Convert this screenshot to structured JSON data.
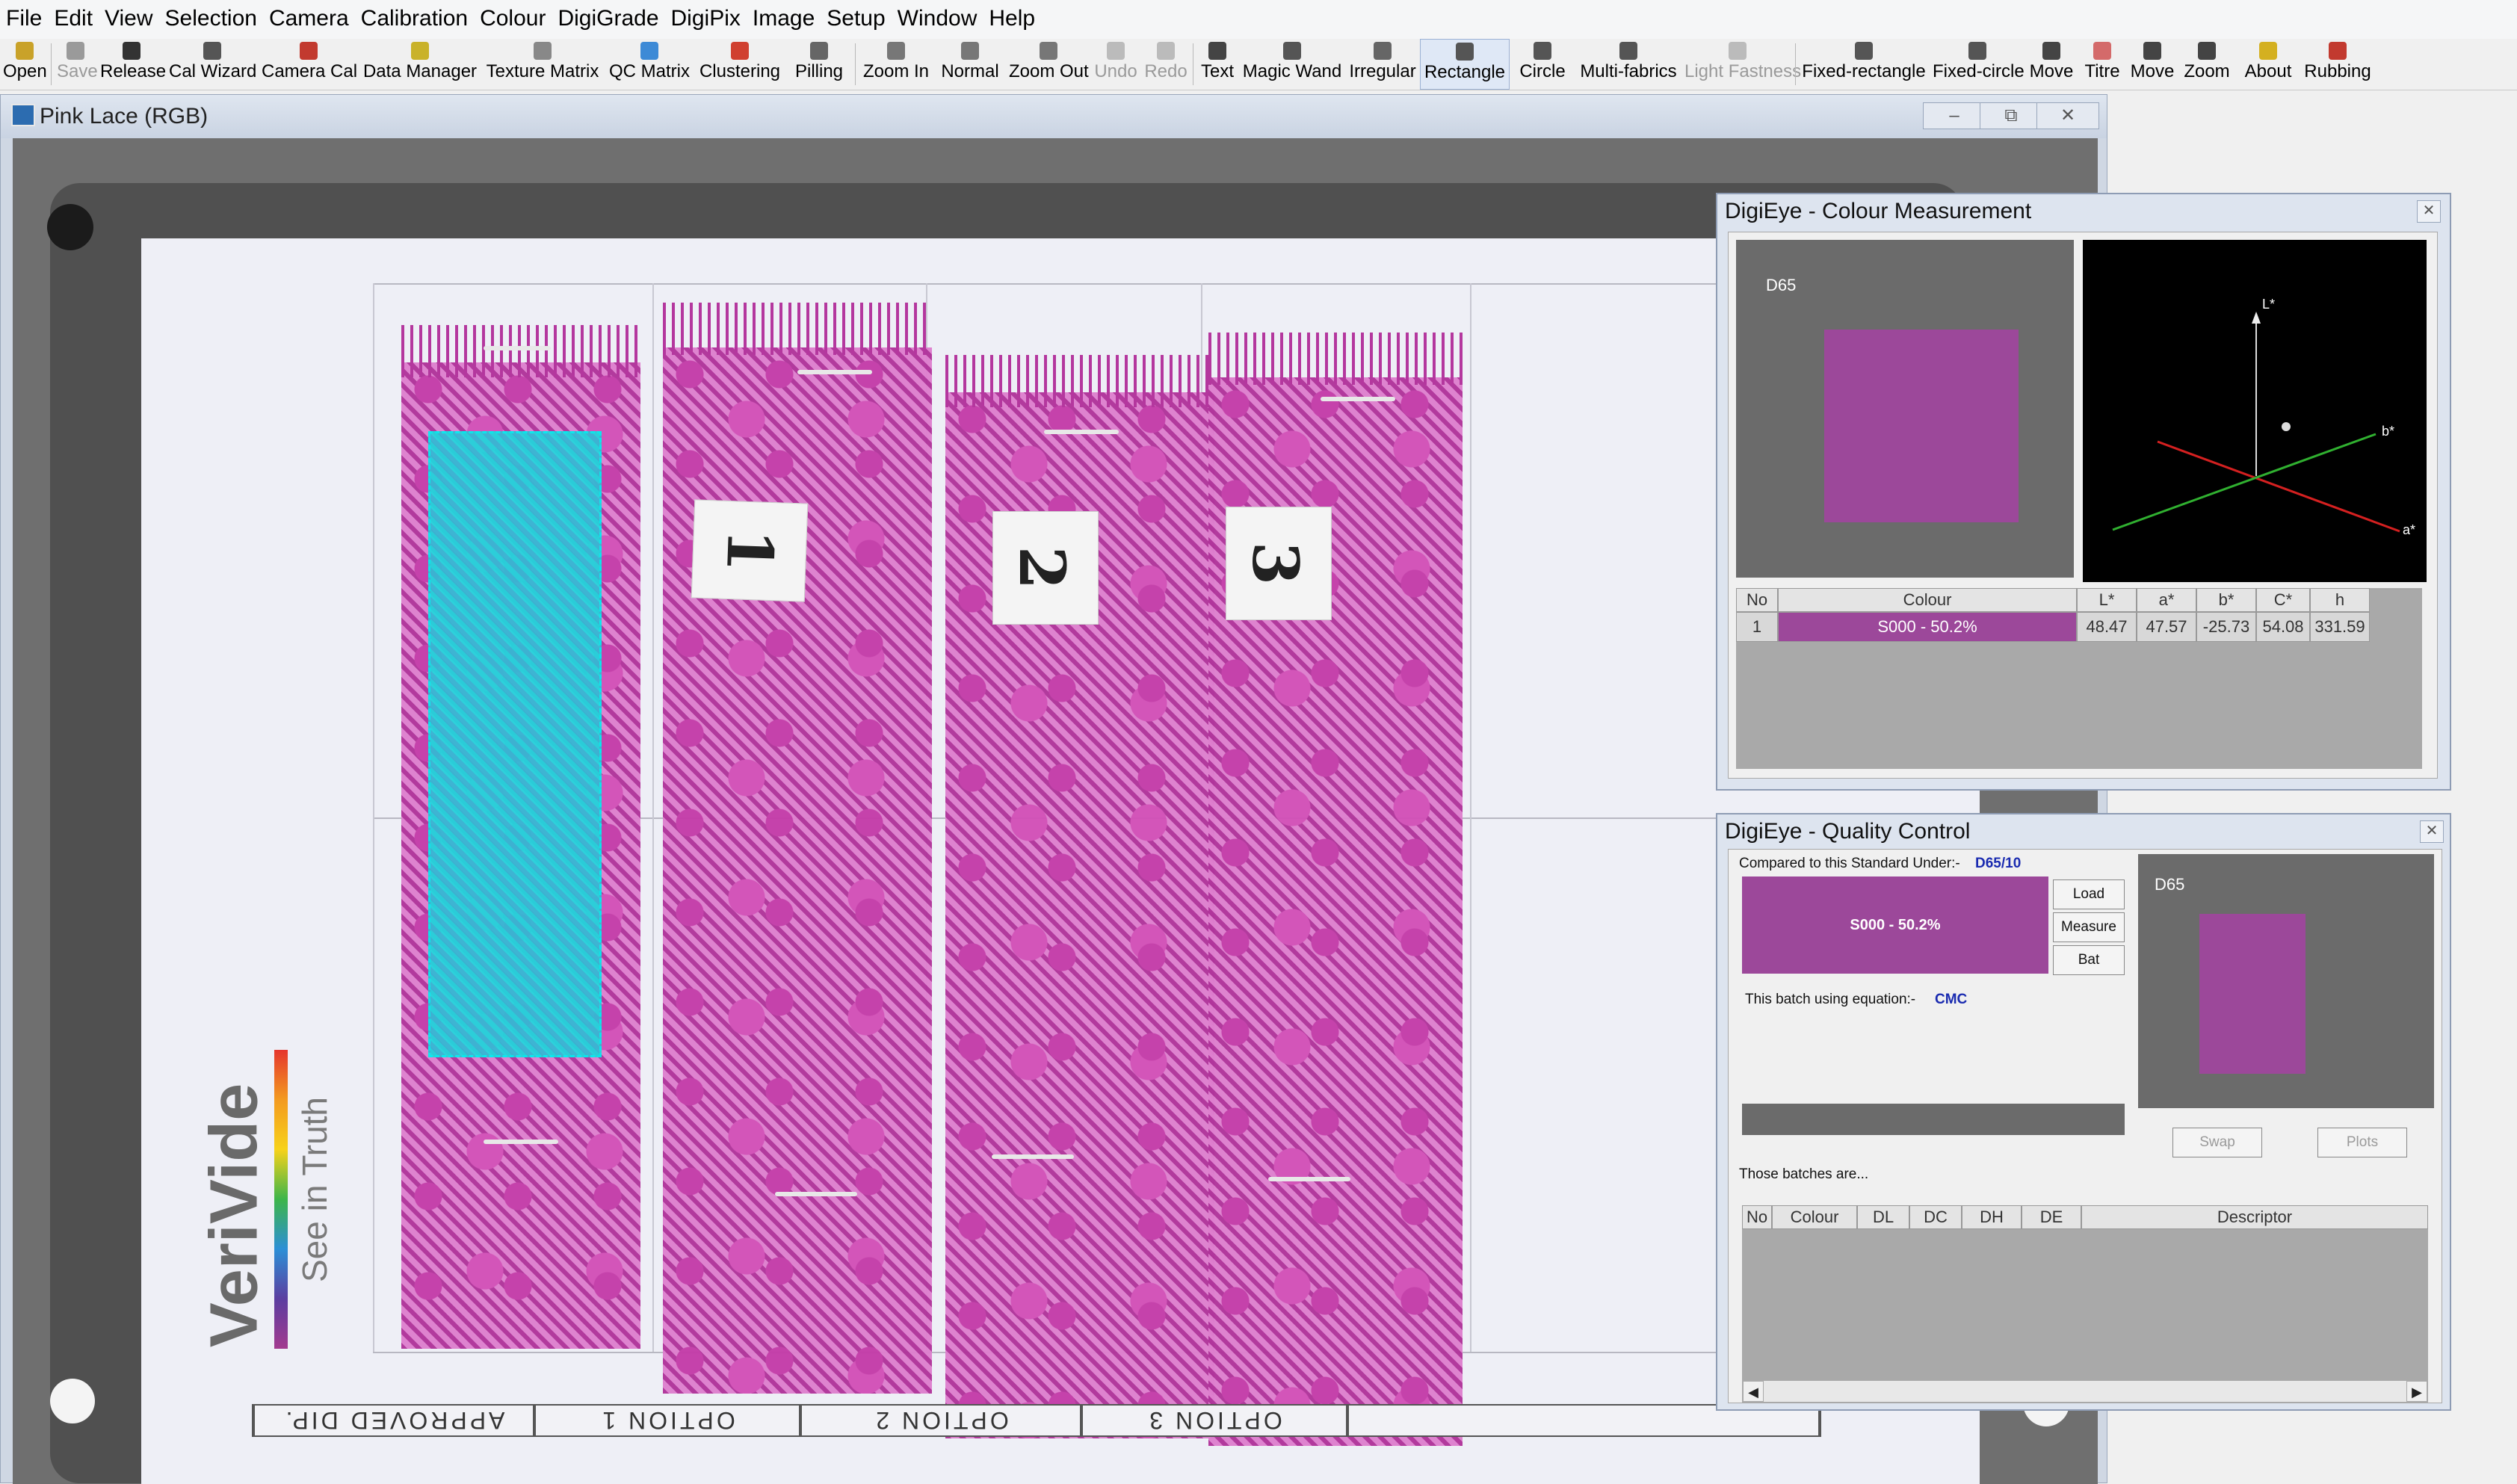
{
  "menu": [
    "File",
    "Edit",
    "View",
    "Selection",
    "Camera",
    "Calibration",
    "Colour",
    "DigiGrade",
    "DigiPix",
    "Image",
    "Setup",
    "Window",
    "Help"
  ],
  "toolbar": [
    {
      "label": "Open",
      "icon": "open-folder-icon",
      "color": "#c9a229",
      "state": "enabled"
    },
    {
      "label": "Save",
      "icon": "save-disk-icon",
      "color": "#9a9a9a",
      "state": "disabled"
    },
    {
      "label": "Release",
      "icon": "release-camera-icon",
      "color": "#333333",
      "state": "enabled"
    },
    {
      "label": "Cal Wizard",
      "icon": "calibration-wizard-icon",
      "color": "#555555",
      "state": "enabled"
    },
    {
      "label": "Camera Cal",
      "icon": "camera-calibration-icon",
      "color": "#c23a2f",
      "state": "enabled"
    },
    {
      "label": "Data Manager",
      "icon": "data-manager-icon",
      "color": "#c9b229",
      "state": "enabled"
    },
    {
      "label": "Texture Matrix",
      "icon": "texture-matrix-icon",
      "color": "#888888",
      "state": "enabled"
    },
    {
      "label": "QC Matrix",
      "icon": "qc-matrix-icon",
      "color": "#3d8ad6",
      "state": "enabled"
    },
    {
      "label": "Clustering",
      "icon": "clustering-icon",
      "color": "#d04030",
      "state": "enabled"
    },
    {
      "label": "Pilling",
      "icon": "pilling-icon",
      "color": "#666666",
      "state": "enabled"
    },
    {
      "label": "Zoom In",
      "icon": "zoom-in-icon",
      "color": "#777777",
      "state": "enabled"
    },
    {
      "label": "Normal",
      "icon": "normal-view-icon",
      "color": "#777777",
      "state": "enabled"
    },
    {
      "label": "Zoom Out",
      "icon": "zoom-out-icon",
      "color": "#777777",
      "state": "enabled"
    },
    {
      "label": "Undo",
      "icon": "undo-icon",
      "color": "#bbbbbb",
      "state": "disabled"
    },
    {
      "label": "Redo",
      "icon": "redo-icon",
      "color": "#bbbbbb",
      "state": "disabled"
    },
    {
      "label": "Text",
      "icon": "text-tool-icon",
      "color": "#444444",
      "state": "enabled"
    },
    {
      "label": "Magic Wand",
      "icon": "magic-wand-icon",
      "color": "#555555",
      "state": "enabled"
    },
    {
      "label": "Irregular",
      "icon": "lasso-icon",
      "color": "#666666",
      "state": "enabled"
    },
    {
      "label": "Rectangle",
      "icon": "rectangle-select-icon",
      "color": "#555555",
      "state": "active"
    },
    {
      "label": "Circle",
      "icon": "circle-select-icon",
      "color": "#555555",
      "state": "enabled"
    },
    {
      "label": "Multi-fabrics",
      "icon": "multi-fabrics-icon",
      "color": "#555555",
      "state": "enabled"
    },
    {
      "label": "Light Fastness",
      "icon": "light-fastness-icon",
      "color": "#bbbbbb",
      "state": "disabled"
    },
    {
      "label": "Fixed-rectangle",
      "icon": "fixed-rectangle-icon",
      "color": "#555555",
      "state": "enabled"
    },
    {
      "label": "Fixed-circle",
      "icon": "fixed-circle-icon",
      "color": "#555555",
      "state": "enabled"
    },
    {
      "label": "Move",
      "icon": "move-cursor-icon",
      "color": "#444444",
      "state": "enabled"
    },
    {
      "label": "Titre",
      "icon": "titre-icon",
      "color": "#d46a6a",
      "state": "enabled"
    },
    {
      "label": "Move",
      "icon": "hand-pan-icon",
      "color": "#444444",
      "state": "enabled"
    },
    {
      "label": "Zoom",
      "icon": "zoom-icon",
      "color": "#444444",
      "state": "enabled"
    },
    {
      "label": "About",
      "icon": "about-bulb-icon",
      "color": "#d4b020",
      "state": "enabled"
    },
    {
      "label": "Rubbing",
      "icon": "rubbing-icon",
      "color": "#c23a2f",
      "state": "enabled"
    }
  ],
  "document": {
    "title": "Pink Lace (RGB)",
    "minimize": "–",
    "restore": "⧉",
    "close": "✕",
    "sample_labels": [
      "1",
      "2",
      "3"
    ],
    "option_labels": [
      "APPROVED DIP.",
      "OPTION 1",
      "OPTION 2",
      "OPTION 3",
      ""
    ],
    "brand_name": "VeriVide",
    "brand_tagline": "See in Truth"
  },
  "colour_measurement": {
    "title": "DigiEye - Colour Measurement",
    "close": "✕",
    "illuminant": "D65",
    "swatch_color": "#9c489a",
    "axis_labels": {
      "l": "L*",
      "a": "a*",
      "b": "b*"
    },
    "table_headers": [
      "No",
      "Colour",
      "L*",
      "a*",
      "b*",
      "C*",
      "h"
    ],
    "rows": [
      {
        "no": "1",
        "colour": "S000 - 50.2%",
        "L": "48.47",
        "a": "47.57",
        "b": "-25.73",
        "C": "54.08",
        "h": "331.59"
      }
    ]
  },
  "quality_control": {
    "title": "DigiEye - Quality Control",
    "close": "✕",
    "standard_label": "Compared to this Standard Under:-",
    "standard_illuminant": "D65/10",
    "standard_name": "S000 - 50.2%",
    "standard_color": "#9c489a",
    "buttons": {
      "load": "Load",
      "measure": "Measure",
      "bat": "Bat",
      "swap": "Swap",
      "plots": "Plots"
    },
    "equation_label": "This batch using equation:-",
    "equation": "CMC",
    "illuminant": "D65",
    "batches_label": "Those batches are...",
    "batch_headers": [
      "No",
      "Colour",
      "DL",
      "DC",
      "DH",
      "DE",
      "Descriptor"
    ],
    "scroll_left": "◀",
    "scroll_right": "▶"
  }
}
